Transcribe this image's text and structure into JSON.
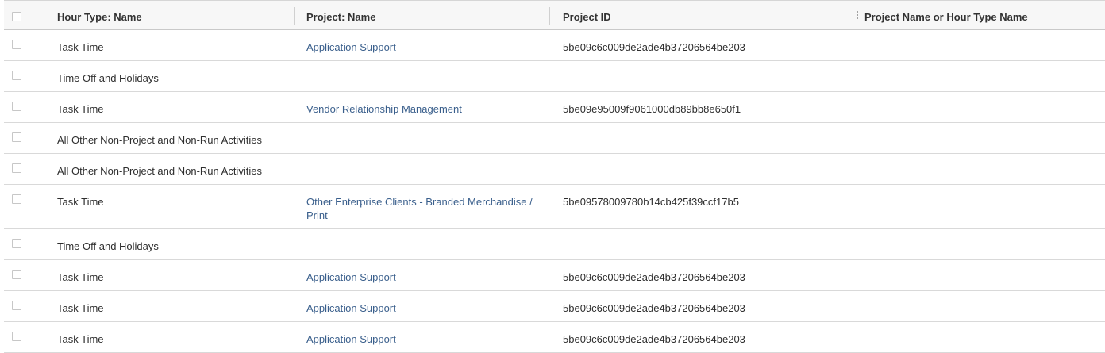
{
  "columns": {
    "hour_type": "Hour Type: Name",
    "project_name": "Project: Name",
    "project_id": "Project ID",
    "combined": "Project Name or Hour Type Name"
  },
  "colors": {
    "link": "#3a5f8c",
    "header_bg": "#f7f7f7",
    "row_border": "#d9d9d9"
  },
  "rows": [
    {
      "hour_type": "Task Time",
      "project_name": "Application Support",
      "project_id": "5be09c6c009de2ade4b37206564be203",
      "combined": ""
    },
    {
      "hour_type": "Time Off and Holidays",
      "project_name": "",
      "project_id": "",
      "combined": ""
    },
    {
      "hour_type": "Task Time",
      "project_name": "Vendor Relationship Management",
      "project_id": "5be09e95009f9061000db89bb8e650f1",
      "combined": ""
    },
    {
      "hour_type": "All Other Non-Project and Non-Run Activities",
      "project_name": "",
      "project_id": "",
      "combined": ""
    },
    {
      "hour_type": "All Other Non-Project and Non-Run Activities",
      "project_name": "",
      "project_id": "",
      "combined": ""
    },
    {
      "hour_type": "Task Time",
      "project_name": "Other Enterprise Clients - Branded Merchandise / Print",
      "project_id": "5be09578009780b14cb425f39ccf17b5",
      "combined": ""
    },
    {
      "hour_type": "Time Off and Holidays",
      "project_name": "",
      "project_id": "",
      "combined": ""
    },
    {
      "hour_type": "Task Time",
      "project_name": "Application Support",
      "project_id": "5be09c6c009de2ade4b37206564be203",
      "combined": ""
    },
    {
      "hour_type": "Task Time",
      "project_name": "Application Support",
      "project_id": "5be09c6c009de2ade4b37206564be203",
      "combined": ""
    },
    {
      "hour_type": "Task Time",
      "project_name": "Application Support",
      "project_id": "5be09c6c009de2ade4b37206564be203",
      "combined": ""
    }
  ]
}
